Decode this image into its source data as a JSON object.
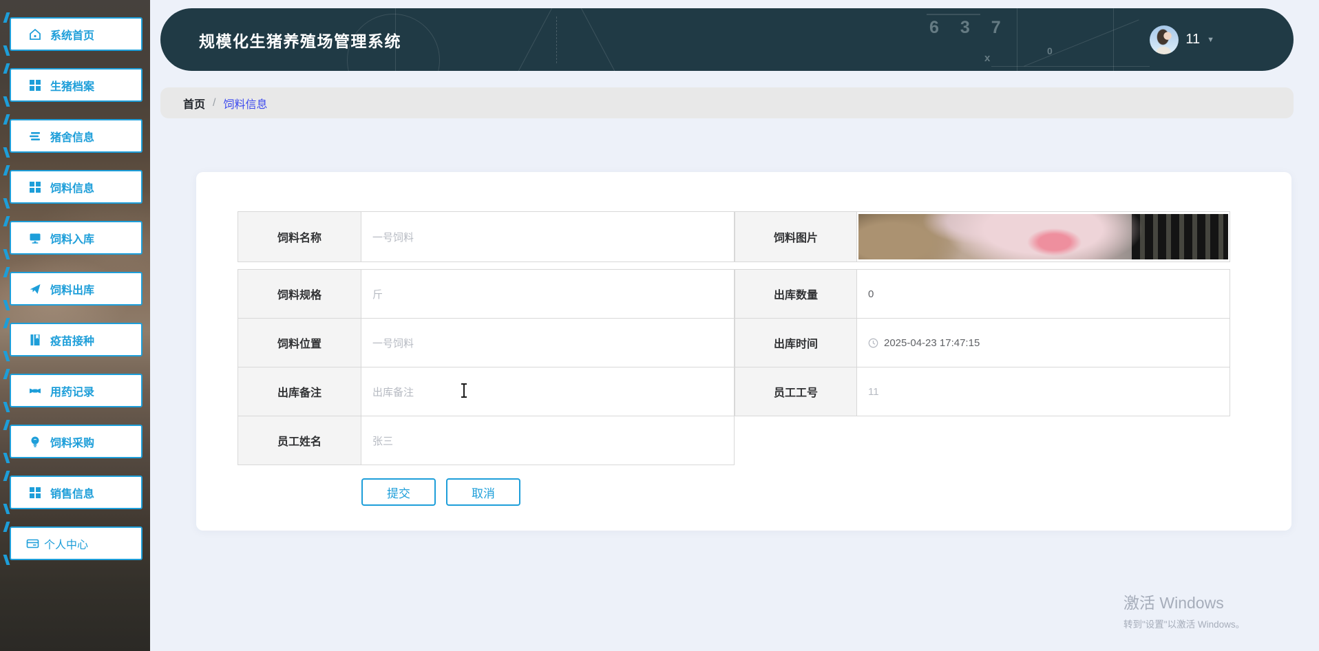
{
  "app": {
    "title": "规模化生猪养殖场管理系统"
  },
  "header": {
    "user_name": "11",
    "caret": "▼",
    "bg_numbers": "6 3 7",
    "bg_x": "x",
    "bg_theta": "0",
    "bg_color": "#203a45"
  },
  "breadcrumb": {
    "home": "首页",
    "separator": "/",
    "current": "饲料信息"
  },
  "sidebar": {
    "accent_color": "#1d9ed9",
    "items": [
      {
        "label": "系统首页",
        "icon": "home-icon"
      },
      {
        "label": "生猪档案",
        "icon": "grid-icon"
      },
      {
        "label": "猪舍信息",
        "icon": "list-icon"
      },
      {
        "label": "饲料信息",
        "icon": "grid-icon"
      },
      {
        "label": "饲料入库",
        "icon": "monitor-icon"
      },
      {
        "label": "饲料出库",
        "icon": "paper-plane-icon"
      },
      {
        "label": "疫苗接种",
        "icon": "notebook-icon"
      },
      {
        "label": "用药记录",
        "icon": "medication-icon"
      },
      {
        "label": "饲料采购",
        "icon": "lightbulb-icon"
      },
      {
        "label": "销售信息",
        "icon": "grid-icon"
      },
      {
        "label": "个人中心",
        "icon": "card-icon"
      }
    ]
  },
  "form": {
    "left": [
      {
        "label": "饲料名称",
        "text": "一号饲料"
      },
      {
        "label": "饲料规格",
        "text": "斤"
      },
      {
        "label": "饲料位置",
        "text": "一号饲料"
      },
      {
        "label": "出库备注",
        "text": "出库备注"
      },
      {
        "label": "员工姓名",
        "text": "张三"
      }
    ],
    "right": [
      {
        "label": "饲料图片",
        "text": ""
      },
      {
        "label": "出库数量",
        "text": "0"
      },
      {
        "label": "出库时间",
        "text": "2025-04-23 17:47:15"
      },
      {
        "label": "员工工号",
        "text": "11"
      }
    ],
    "submit_label": "提交",
    "cancel_label": "取消"
  },
  "watermark": {
    "line1": "激活 Windows",
    "line2": "转到\"设置\"以激活 Windows。"
  }
}
